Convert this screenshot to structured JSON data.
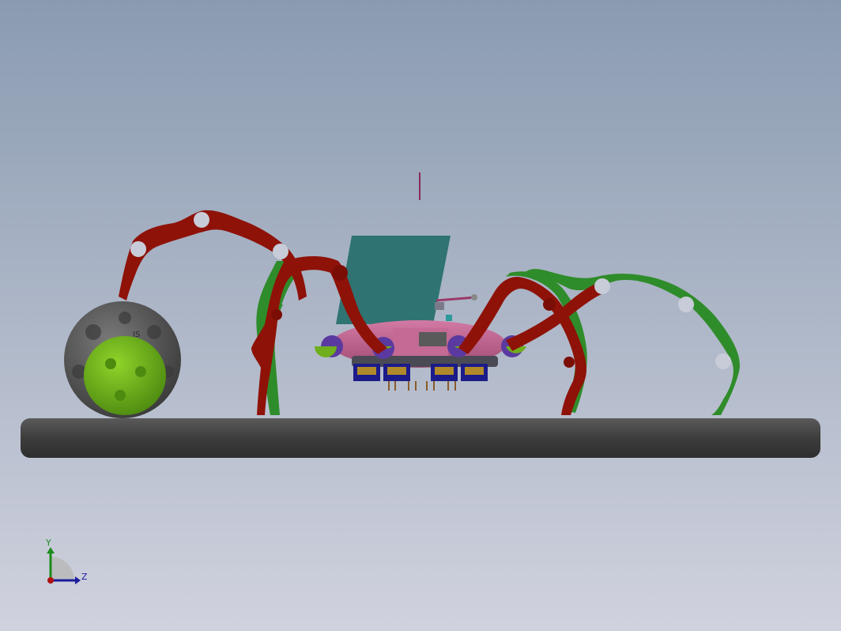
{
  "viewport": {
    "background_top": "#8a9bb1",
    "background_bottom": "#d0d2de"
  },
  "colors": {
    "leg_red": "#8e1208",
    "leg_red_shade": "#6a0c05",
    "leg_green": "#2f8c2a",
    "leg_green_shade": "#1f6a1c",
    "ball_gray": "#5a5a5a",
    "ball_green": "#6fae1c",
    "body_pink": "#c2608f",
    "panel_teal": "#2f7373",
    "servo_blue": "#1b1b8a",
    "servo_gold": "#b08a2a",
    "ground_dark": "#3a3a3a"
  },
  "triad": {
    "y_label": "Y",
    "z_label": "Z",
    "y_color": "#1c8a1c",
    "z_color": "#1c1c9c",
    "x_color": "#b01010"
  },
  "ball": {
    "engraving": "IS"
  }
}
